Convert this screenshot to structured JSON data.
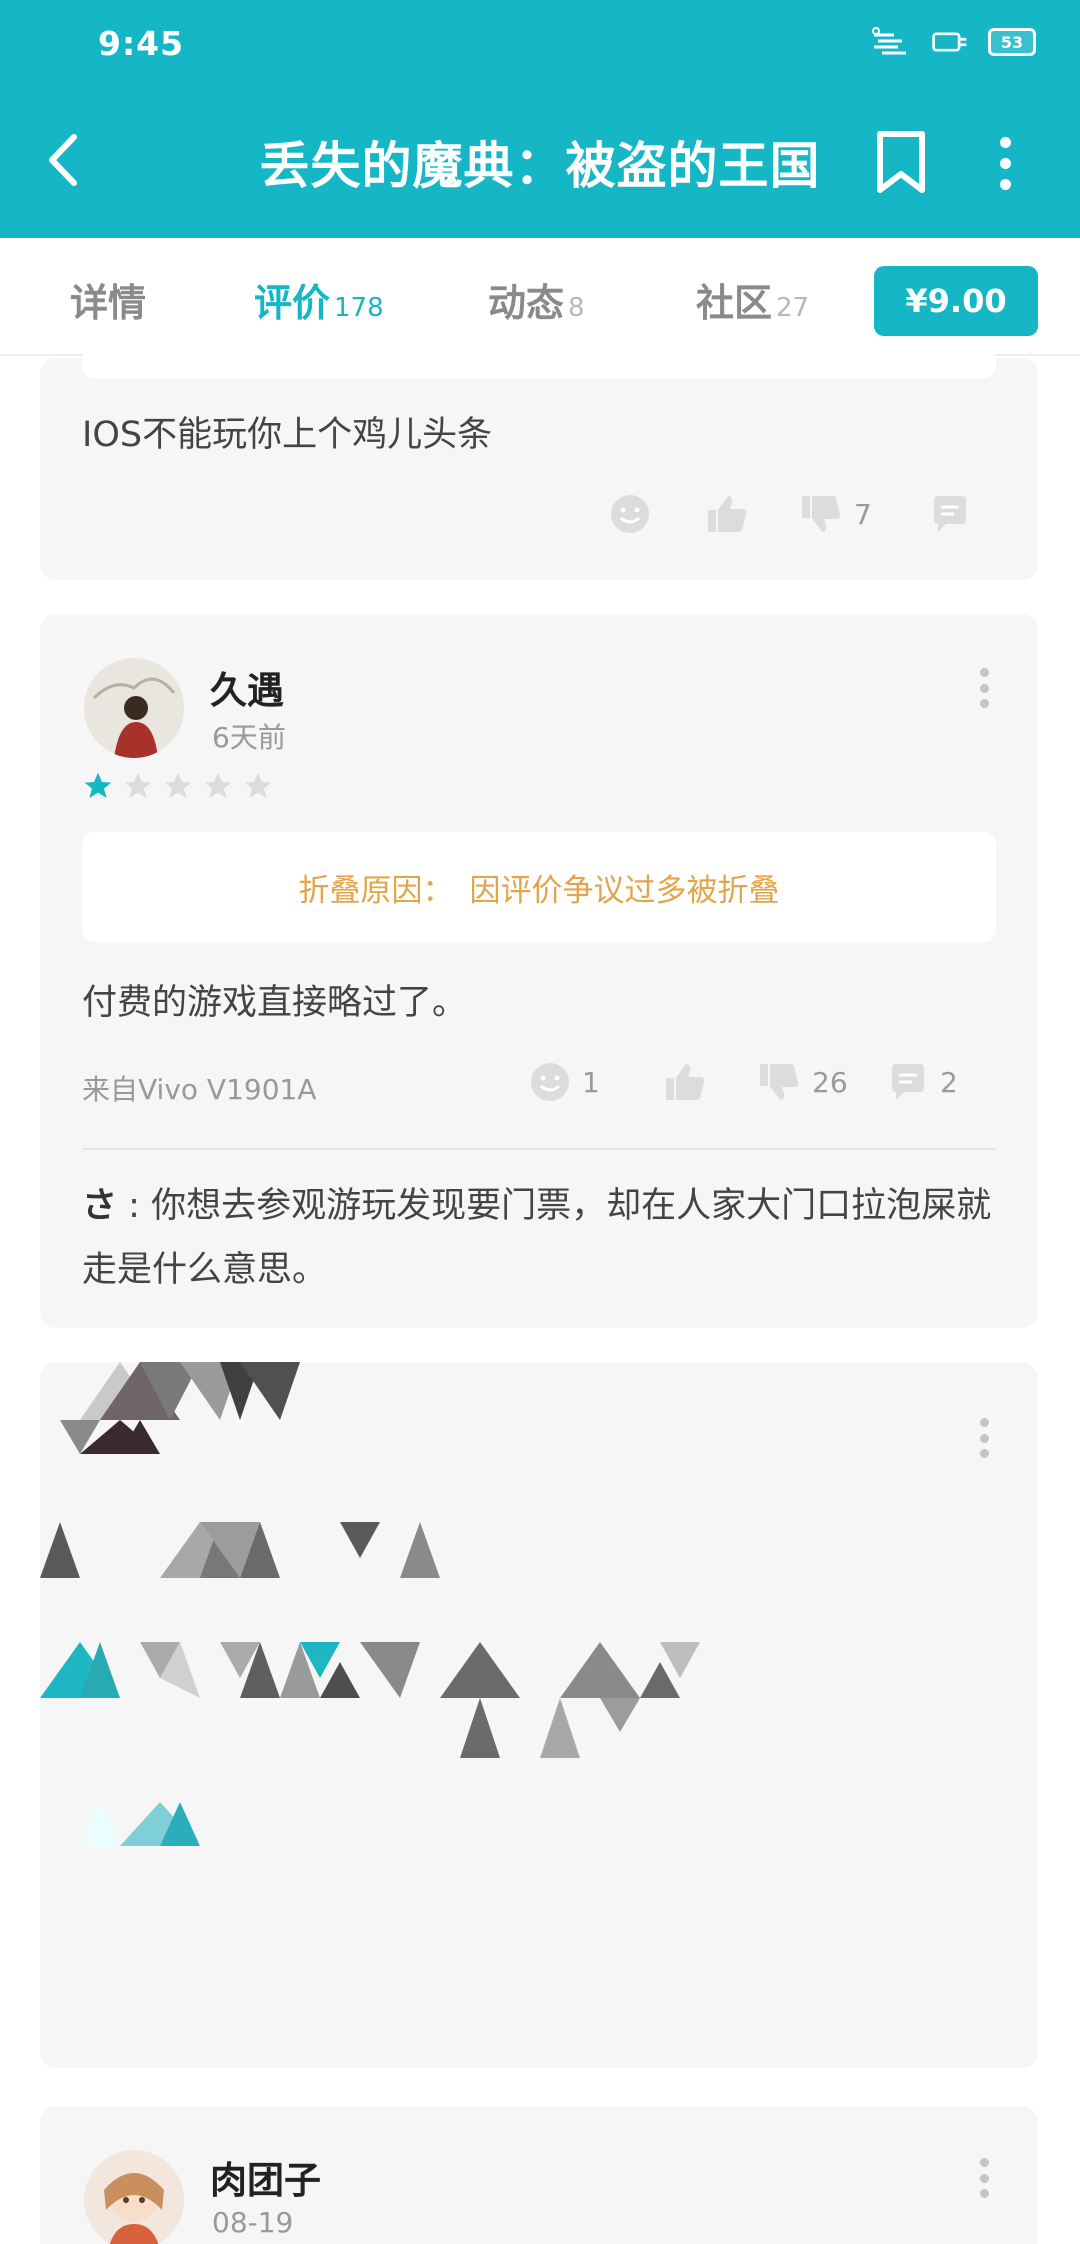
{
  "status_bar": {
    "time": "9:45",
    "battery_label": "53"
  },
  "header": {
    "title": "丢失的魔典：被盗的王国",
    "back_icon": "back-arrow-icon",
    "bookmark_icon": "bookmark-icon",
    "more_icon": "more-vertical-icon"
  },
  "tabs": [
    {
      "label": "详情",
      "count": ""
    },
    {
      "label": "评价",
      "count": "178"
    },
    {
      "label": "动态",
      "count": "8"
    },
    {
      "label": "社区",
      "count": "27"
    }
  ],
  "price_button": "¥9.00",
  "colors": {
    "accent": "#15b7c7",
    "fold_text": "#e2a54a",
    "card_bg": "#f6f6f6"
  },
  "reviews": [
    {
      "text": "IOS不能玩你上个鸡儿头条",
      "dislikes": "7"
    },
    {
      "user": "久遇",
      "time": "6天前",
      "rating": 1,
      "fold_label": "折叠原因：",
      "fold_reason": "因评价争议过多被折叠",
      "text": "付费的游戏直接略过了。",
      "device": "来自Vivo V1901A",
      "funny": "1",
      "dislikes": "26",
      "comments": "2",
      "reply_user": "さ",
      "reply_sep": " : ",
      "reply_text": "你想去参观游玩发现要门票，却在人家大门口拉泡屎就走是什么意思。"
    },
    {
      "user": "肉团子",
      "time": "08-19"
    }
  ]
}
